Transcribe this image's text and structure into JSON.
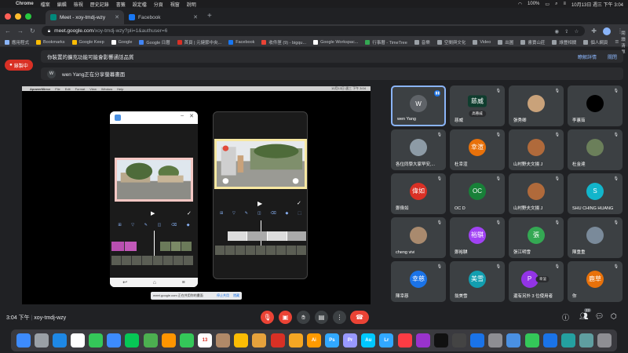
{
  "menubar": {
    "app": "Chrome",
    "items": [
      "檔案",
      "編輯",
      "檢視",
      "歷史記錄",
      "書籤",
      "設定檔",
      "分頁",
      "視窗",
      "說明"
    ],
    "battery": "100%",
    "datetime": "10月13日 週三 下午 3:04"
  },
  "tabs": [
    {
      "title": "Meet - xoy-tmdj-wzy",
      "active": true,
      "color": "#00897b"
    },
    {
      "title": "Facebook",
      "active": false,
      "color": "#1877f2"
    }
  ],
  "address": {
    "host": "meet.google.com",
    "path": "/xoy-tmdj-wzy?pli=1&authuser=6"
  },
  "bookmarks": {
    "items": [
      "應用程式",
      "Bookmarks",
      "Google Keep",
      "Google",
      "Google 日曆",
      "首頁 | 元健節中央...",
      "Facebook",
      "收件匣 (9) - bigqu...",
      "Google Workspac...",
      "行事曆 - TimeTree",
      "音樂",
      "空間與文化",
      "Video",
      "出圖",
      "書寶山莊",
      "綠豐相關",
      "個人網頁"
    ],
    "reading_list": "閱讀清單"
  },
  "meet": {
    "recording_label": "錄製中",
    "banner1_text": "你裝置的擴充功能可能會影響通話品質",
    "banner1_action1": "瞭解詳情",
    "banner1_action2": "關閉",
    "banner2_initial": "W",
    "banner2_text": "wen Yang正在分享螢幕畫面",
    "share_notice": "meet.google.com 正在共用你的畫面",
    "share_stop": "停止共用",
    "share_hide": "隱藏",
    "meeting_time": "3:04 下午",
    "meeting_code": "xoy-tmdj-wzy",
    "participant_badge": "23"
  },
  "screen": {
    "app_menu": [
      "ApowerMirror",
      "File",
      "Edit",
      "Format",
      "View",
      "Window",
      "Help"
    ],
    "clock": "10月13日 週三 下午 3:04"
  },
  "participants": [
    {
      "name": "wen Yang",
      "initial": "W",
      "color": "#5f6368",
      "active": true
    },
    {
      "name": "慈威",
      "initial": "",
      "label": "慈威",
      "chip": "高慈威",
      "color": "#0f3d2e"
    },
    {
      "name": "張秀卿",
      "initial": "",
      "color": "#c9a27a"
    },
    {
      "name": "李蕙茹",
      "initial": "",
      "color": "#000000"
    },
    {
      "name": "各位同學大家早安,...",
      "initial": "",
      "color": "#8d9ba6"
    },
    {
      "name": "杜幸渲",
      "initial": "幸渲",
      "color": "#e8710a"
    },
    {
      "name": "山村野夫文揚 J",
      "initial": "",
      "color": "#b06a3b"
    },
    {
      "name": "杜金達",
      "initial": "",
      "color": "#6b7f5a"
    },
    {
      "name": "鄭偉如",
      "initial": "偉如",
      "color": "#d93025"
    },
    {
      "name": "OC D",
      "initial": "OC",
      "color": "#188038"
    },
    {
      "name": "山村野夫文揚 J",
      "initial": "",
      "color": "#b06a3b"
    },
    {
      "name": "SHU CHING HUANG",
      "initial": "S",
      "color": "#12b5cb"
    },
    {
      "name": "cheng vivi",
      "initial": "",
      "color": "#a98a6e"
    },
    {
      "name": "鄭裕騏",
      "initial": "裕騏",
      "color": "#a142f4"
    },
    {
      "name": "張江明雪",
      "initial": "張",
      "color": "#34a853"
    },
    {
      "name": "陳重重",
      "initial": "",
      "color": "#7a8a9a"
    },
    {
      "name": "陳幸慈",
      "initial": "幸慈",
      "color": "#1a73e8"
    },
    {
      "name": "翁美雪",
      "initial": "美雪",
      "color": "#129eaf"
    },
    {
      "name": "還有另外 3 位使用者",
      "initial": "P",
      "chip": "幸渲",
      "color": "#9334e6"
    },
    {
      "name": "你",
      "initial": "鹿草",
      "color": "#e8710a"
    }
  ],
  "dock": [
    "Finder",
    "Launchpad",
    "Safari",
    "Chrome",
    "Messages",
    "Mail",
    "LINE",
    "Maps",
    "Photos",
    "FaceTime",
    "Calendar",
    "Contacts",
    "Notes",
    "Pencil",
    "Acrobat",
    "Sketch",
    "Ai",
    "Ps",
    "Pr",
    "Au",
    "Lr",
    "Music",
    "Podcasts",
    "TV",
    "Calculator",
    "App Store",
    "Settings",
    "Preview",
    "Numbers",
    "Keynote",
    "Mirror",
    "Downloads",
    "Trash"
  ],
  "dock_badge": "13"
}
